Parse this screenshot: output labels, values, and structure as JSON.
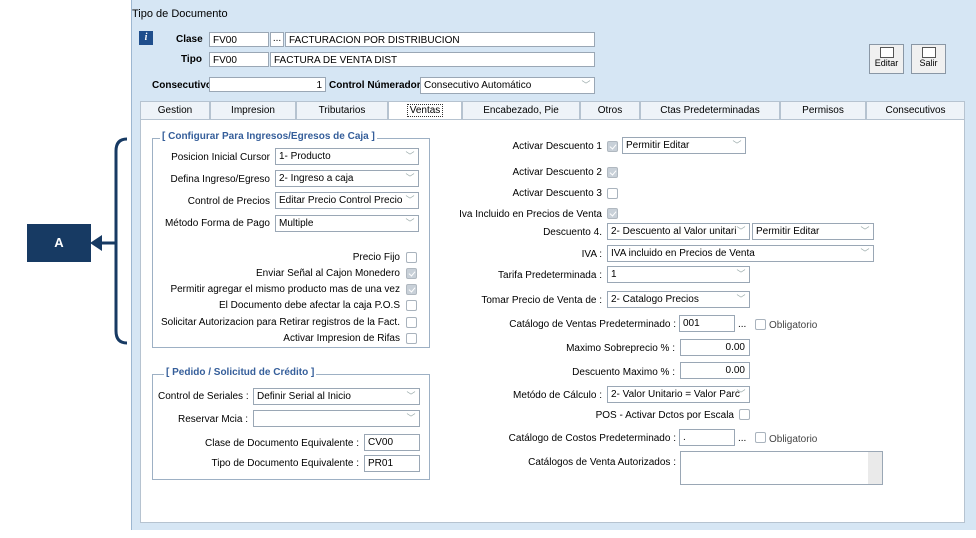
{
  "window": {
    "title": "Tipo de Documento"
  },
  "header": {
    "clase_label": "Clase",
    "clase_code": "FV00",
    "clase_desc": "FACTURACION POR DISTRIBUCION",
    "tipo_label": "Tipo",
    "tipo_code": "FV00",
    "tipo_desc": "FACTURA DE VENTA DIST",
    "consecutivo_label": "Consecutivo",
    "consecutivo_value": "1",
    "control_label": "Control Númerador :",
    "control_value": "Consecutivo Automático",
    "dots": "..."
  },
  "toolbar": {
    "editar_label": "Editar",
    "salir_label": "Salir"
  },
  "tabs": [
    "Gestion",
    "Impresion",
    "Tributarios",
    "Ventas",
    "Encabezado, Pie",
    "Otros",
    "Ctas Predeterminadas",
    "Permisos",
    "Consecutivos"
  ],
  "config_group": {
    "title": "[ Configurar Para  Ingresos/Egresos de Caja ]",
    "posicion_label": "Posicion Inicial Cursor",
    "posicion_value": "1- Producto",
    "ingreso_label": "Defina Ingreso/Egreso",
    "ingreso_value": "2- Ingreso a caja",
    "precios_label": "Control de Precios",
    "precios_value": "Editar Precio Control Precio",
    "forma_pago_label": "Método Forma de Pago",
    "forma_pago_value": "Multiple",
    "checks": [
      {
        "label": "Precio Fijo",
        "checked": false
      },
      {
        "label": "Enviar Señal al Cajon Monedero",
        "checked": true
      },
      {
        "label": "Permitir agregar el mismo producto mas de una vez",
        "checked": true
      },
      {
        "label": "El Documento debe afectar la caja P.O.S",
        "checked": false
      },
      {
        "label": "Solicitar Autorizacion para Retirar registros de la Fact.",
        "checked": false
      },
      {
        "label": "Activar Impresion de Rifas",
        "checked": false
      }
    ]
  },
  "pedido_group": {
    "title": "[ Pedido / Solicitud de Crédito ]",
    "seriales_label": "Control de Seriales :",
    "seriales_value": "Definir Serial al Inicio",
    "reservar_label": "Reservar Mcia :",
    "reservar_value": "",
    "clase_equiv_label": "Clase  de Documento Equivalente :",
    "clase_equiv_value": "CV00",
    "tipo_equiv_label": "Tipo  de Documento Equivalente :",
    "tipo_equiv_value": "PR01"
  },
  "right": {
    "desc1_label": "Activar Descuento 1",
    "desc1_mode": "Permitir Editar",
    "desc2_label": "Activar Descuento 2",
    "desc3_label": "Activar Descuento 3",
    "iva_incl_label": "Iva Incluido en  Precios de Venta",
    "desc4_label": "Descuento 4.",
    "desc4_value": "2- Descuento al Valor unitari",
    "desc4_mode": "Permitir Editar",
    "iva_label": "IVA :",
    "iva_value": "IVA incluido en Precios de Venta",
    "tarifa_label": "Tarifa Predeterminada :",
    "tarifa_value": "1",
    "tomar_label": "Tomar Precio de Venta de :",
    "tomar_value": "2- Catalogo Precios",
    "catalogo_label": "Catálogo de Ventas Predeterminado :",
    "catalogo_value": "001",
    "obligatorio_label": "Obligatorio",
    "max_sobre_label": "Maximo Sobreprecio % :",
    "max_sobre_value": "0.00",
    "desc_max_label": "Descuento Maximo  % :",
    "desc_max_value": "0.00",
    "metodo_label": "Metódo de Cálculo :",
    "metodo_value": "2- Valor Unitario = Valor Parc",
    "pos_label": "POS - Activar Dctos por Escala",
    "costos_label": "Catálogo de Costos Predeterminado :",
    "costos_value": ".",
    "obligatorio2_label": "Obligatorio",
    "autorizados_label": "Catálogos de Venta Autorizados :"
  },
  "annotation": {
    "label": "A"
  }
}
